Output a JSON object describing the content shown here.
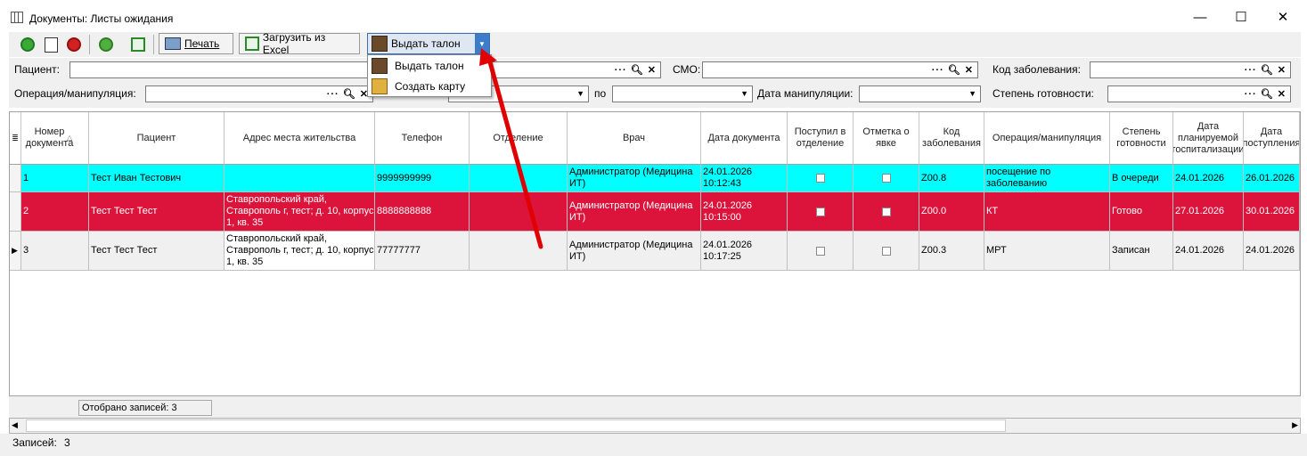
{
  "window": {
    "title": "Документы: Листы ожидания",
    "minimize": "—",
    "maximize": "☐",
    "close": "✕"
  },
  "toolbar": {
    "print_label": "Печать",
    "excel_label": "Загрузить из Excel",
    "issue_label": "Выдать талон"
  },
  "dropdown": {
    "items": [
      "Выдать талон",
      "Создать карту"
    ]
  },
  "filters": {
    "patient": "Пациент:",
    "smo": "СМО:",
    "disease_code": "Код заболевания:",
    "operation": "Операция/манипуляция:",
    "po": "по",
    "manip_date": "Дата манипуляции:",
    "readiness": "Степень готовности:"
  },
  "grid": {
    "headers": [
      "Номер документа",
      "Пациент",
      "Адрес места жительства",
      "Телефон",
      "Отделение",
      "Врач",
      "Дата документа",
      "Поступил в отделение",
      "Отметка о явке",
      "Код заболевания",
      "Операция/манипуляция",
      "Степень готовности",
      "Дата планируемой госпитализации",
      "Дата поступления"
    ],
    "rows": [
      {
        "num": "1",
        "patient": "Тест Иван Тестович",
        "address": "",
        "phone": "9999999999",
        "dept": "",
        "doctor": "Администратор (Медицина ИТ)",
        "date": "24.01.2026 10:12:43",
        "code": "Z00.8",
        "operation": "посещение по заболеванию",
        "status": "В очереди",
        "planned": "24.01.2026",
        "arrived": "26.01.2026",
        "bg": "#00ffff",
        "fg": "#000000"
      },
      {
        "num": "2",
        "patient": "Тест Тест Тест",
        "address": "Ставропольский край, Ставрополь г, тест; д. 10, корпус 1, кв. 35",
        "phone": "8888888888",
        "dept": "",
        "doctor": "Администратор (Медицина ИТ)",
        "date": "24.01.2026 10:15:00",
        "code": "Z00.0",
        "operation": "КТ",
        "status": "Готово",
        "planned": "27.01.2026",
        "arrived": "30.01.2026",
        "bg": "#dc143c",
        "fg": "#ffffff"
      },
      {
        "num": "3",
        "patient": "Тест Тест Тест",
        "address": "Ставропольский край, Ставрополь г, тест; д. 10, корпус 1, кв. 35",
        "phone": "77777777",
        "dept": "",
        "doctor": "Администратор (Медицина ИТ)",
        "date": "24.01.2026 10:17:25",
        "code": "Z00.3",
        "operation": "МРТ",
        "status": "Записан",
        "planned": "24.01.2026",
        "arrived": "24.01.2026",
        "bg": "#f0f0f0",
        "fg": "#000000"
      }
    ]
  },
  "footer": {
    "shown": "Отобрано записей: 3"
  },
  "status": {
    "records": "Записей:",
    "count": "3"
  }
}
